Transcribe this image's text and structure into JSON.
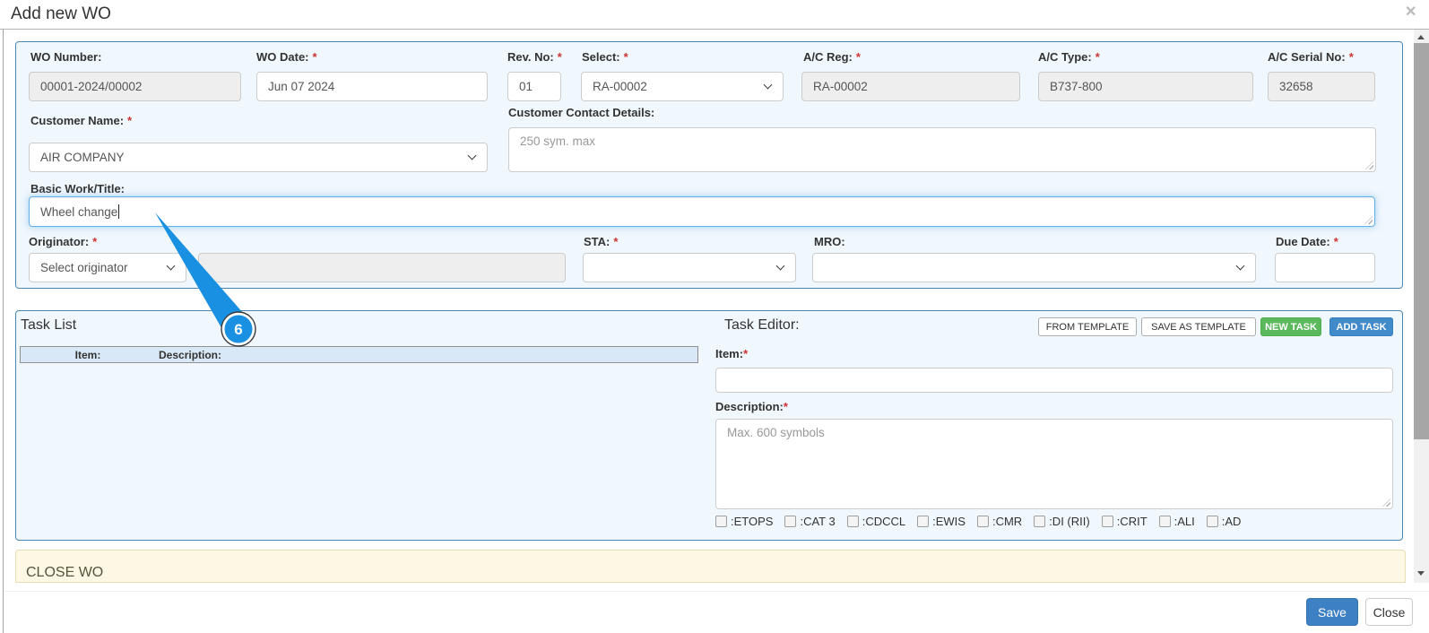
{
  "dialog": {
    "title": "Add new WO",
    "close_icon": "✕"
  },
  "misc": {
    "req": "*"
  },
  "form": {
    "wo_number": {
      "label": "WO Number:",
      "value": "00001-2024/00002"
    },
    "wo_date": {
      "label": "WO Date:",
      "value": "Jun 07 2024"
    },
    "rev_no": {
      "label": "Rev. No:",
      "value": "01"
    },
    "select_ac": {
      "label": "Select:",
      "value": "RA-00002"
    },
    "ac_reg": {
      "label": "A/C Reg:",
      "value": "RA-00002"
    },
    "ac_type": {
      "label": "A/C Type:",
      "value": "B737-800"
    },
    "ac_serial": {
      "label": "A/C Serial No:",
      "value": "32658"
    },
    "customer_name": {
      "label": "Customer Name:",
      "value": "AIR COMPANY"
    },
    "customer_contact": {
      "label": "Customer Contact Details:",
      "placeholder": "250 sym. max"
    },
    "basic_work": {
      "label": "Basic Work/Title:",
      "value": "Wheel change"
    },
    "originator": {
      "label": "Originator:",
      "value": "Select originator"
    },
    "sta": {
      "label": "STA:"
    },
    "mro": {
      "label": "MRO:"
    },
    "due_date": {
      "label": "Due Date:"
    }
  },
  "task_list": {
    "title": "Task List",
    "columns": [
      "Item:",
      "Description:"
    ]
  },
  "task_editor": {
    "title": "Task Editor:",
    "buttons": [
      {
        "label": "FROM TEMPLATE"
      },
      {
        "label": "SAVE AS TEMPLATE"
      },
      {
        "label": "NEW TASK"
      },
      {
        "label": "ADD TASK"
      }
    ],
    "item_label": "Item:",
    "description_label": "Description:",
    "description_placeholder": "Max. 600 symbols",
    "checkboxes": [
      ":ETOPS",
      ":CAT 3",
      ":CDCCL",
      ":EWIS",
      ":CMR",
      ":DI (RII)",
      ":CRIT",
      ":ALI",
      ":AD"
    ]
  },
  "close_wo": {
    "title": "CLOSE WO"
  },
  "footer": {
    "save": "Save",
    "close": "Close"
  },
  "annotation": {
    "step": "6"
  }
}
